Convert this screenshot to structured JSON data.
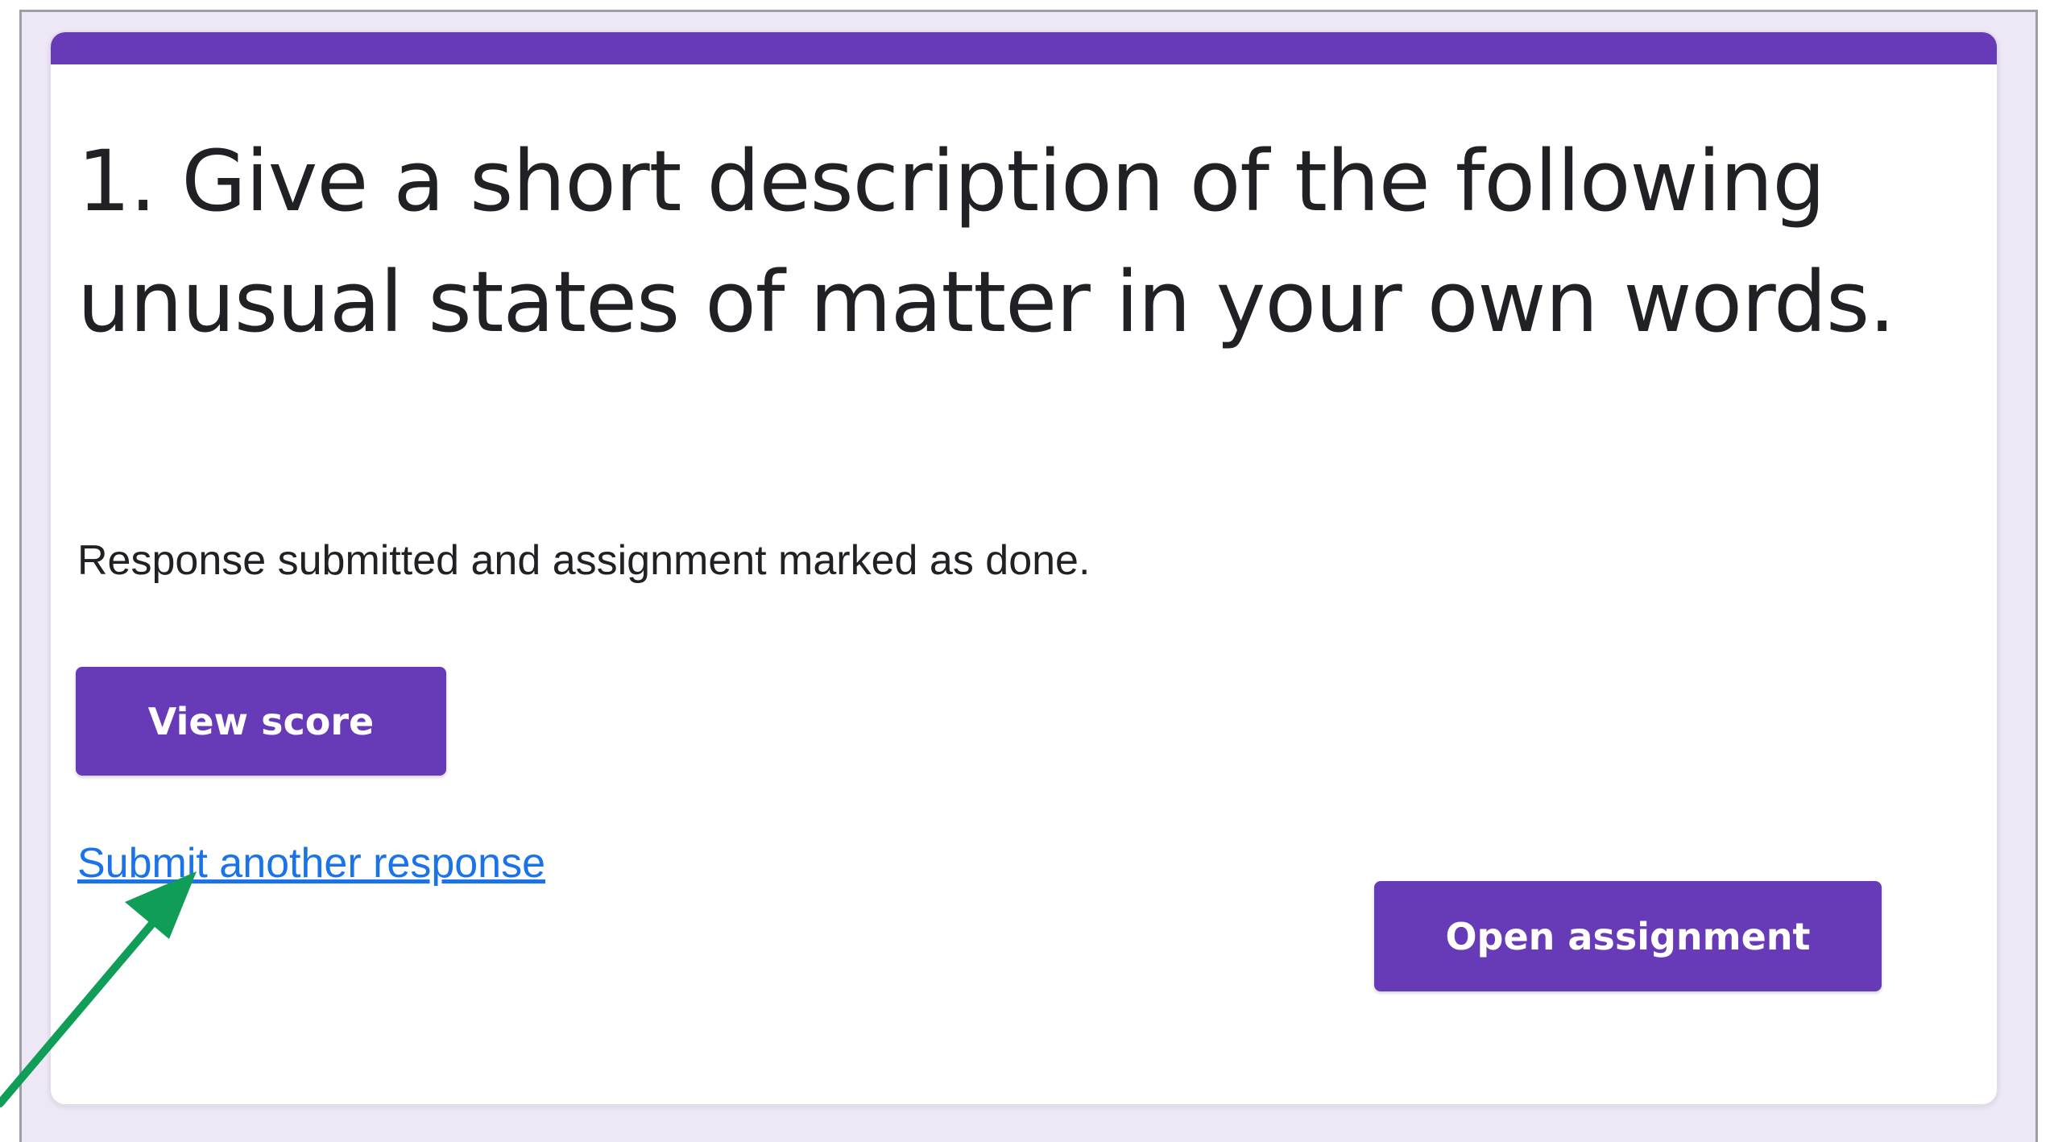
{
  "form": {
    "title": "1. Give a short description of the following unusual states of matter in your own words.",
    "confirmation_message": "Response submitted and assignment marked as done.",
    "view_score_label": "View score",
    "submit_another_label": "Submit another response",
    "open_assignment_label": "Open assignment"
  },
  "colors": {
    "accent": "#673ab7",
    "link": "#1a73e8",
    "background": "#ede7f6",
    "annotation_arrow": "#0f9d58"
  },
  "annotation": {
    "icon": "arrow-icon"
  }
}
